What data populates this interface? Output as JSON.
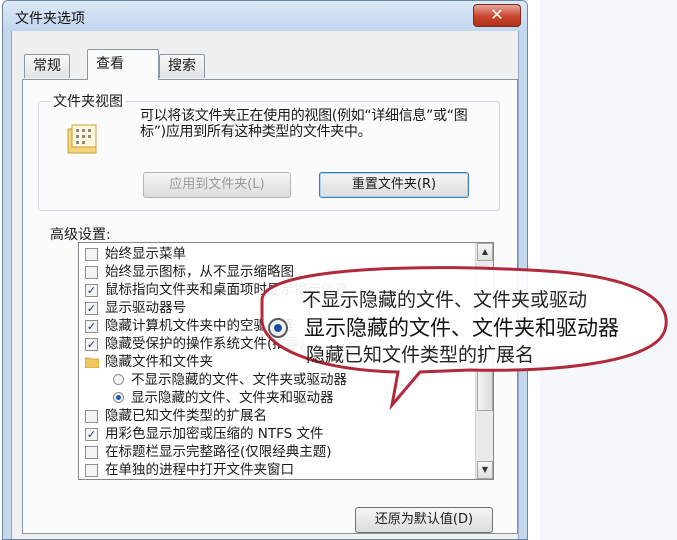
{
  "window": {
    "title": "文件夹选项",
    "close_glyph": "✕"
  },
  "tabs": [
    {
      "label": "常规",
      "active": false
    },
    {
      "label": "查看",
      "active": true
    },
    {
      "label": "搜索",
      "active": false
    }
  ],
  "folder_views": {
    "title": "文件夹视图",
    "description": "可以将该文件夹正在使用的视图(例如“详细信息”或“图标”)应用到所有这种类型的文件夹中。",
    "apply_button": "应用到文件夹(L)",
    "reset_button": "重置文件夹(R)"
  },
  "advanced": {
    "label": "高级设置:",
    "items": [
      {
        "text": "始终显示菜单",
        "type": "checkbox",
        "checked": false
      },
      {
        "text": "始终显示图标，从不显示缩略图",
        "type": "checkbox",
        "checked": false
      },
      {
        "text": "鼠标指向文件夹和桌面项时显示提示信息",
        "type": "checkbox",
        "checked": true
      },
      {
        "text": "显示驱动器号",
        "type": "checkbox",
        "checked": true
      },
      {
        "text": "隐藏计算机文件夹中的空驱动器",
        "type": "checkbox",
        "checked": true
      },
      {
        "text": "隐藏受保护的操作系统文件(推荐)",
        "type": "checkbox",
        "checked": true
      },
      {
        "text": "隐藏文件和文件夹",
        "type": "folder",
        "checked": false
      },
      {
        "text": "不显示隐藏的文件、文件夹或驱动器",
        "type": "radio",
        "checked": false
      },
      {
        "text": "显示隐藏的文件、文件夹和驱动器",
        "type": "radio",
        "checked": true
      },
      {
        "text": "隐藏已知文件类型的扩展名",
        "type": "checkbox",
        "checked": false
      },
      {
        "text": "用彩色显示加密或压缩的 NTFS 文件",
        "type": "checkbox",
        "checked": true
      },
      {
        "text": "在标题栏显示完整路径(仅限经典主题)",
        "type": "checkbox",
        "checked": false
      },
      {
        "text": "在单独的进程中打开文件夹窗口",
        "type": "checkbox",
        "checked": false
      }
    ],
    "restore_button": "还原为默认值(D)"
  },
  "callout": {
    "line1": "不显示隐藏的文件、文件夹或驱动",
    "line2": "显示隐藏的文件、文件夹和驱动器",
    "line3": "隐藏已知文件类型的扩展名"
  },
  "colors": {
    "callout_stroke": "#b02a3c",
    "accent": "#1f5bb0"
  }
}
